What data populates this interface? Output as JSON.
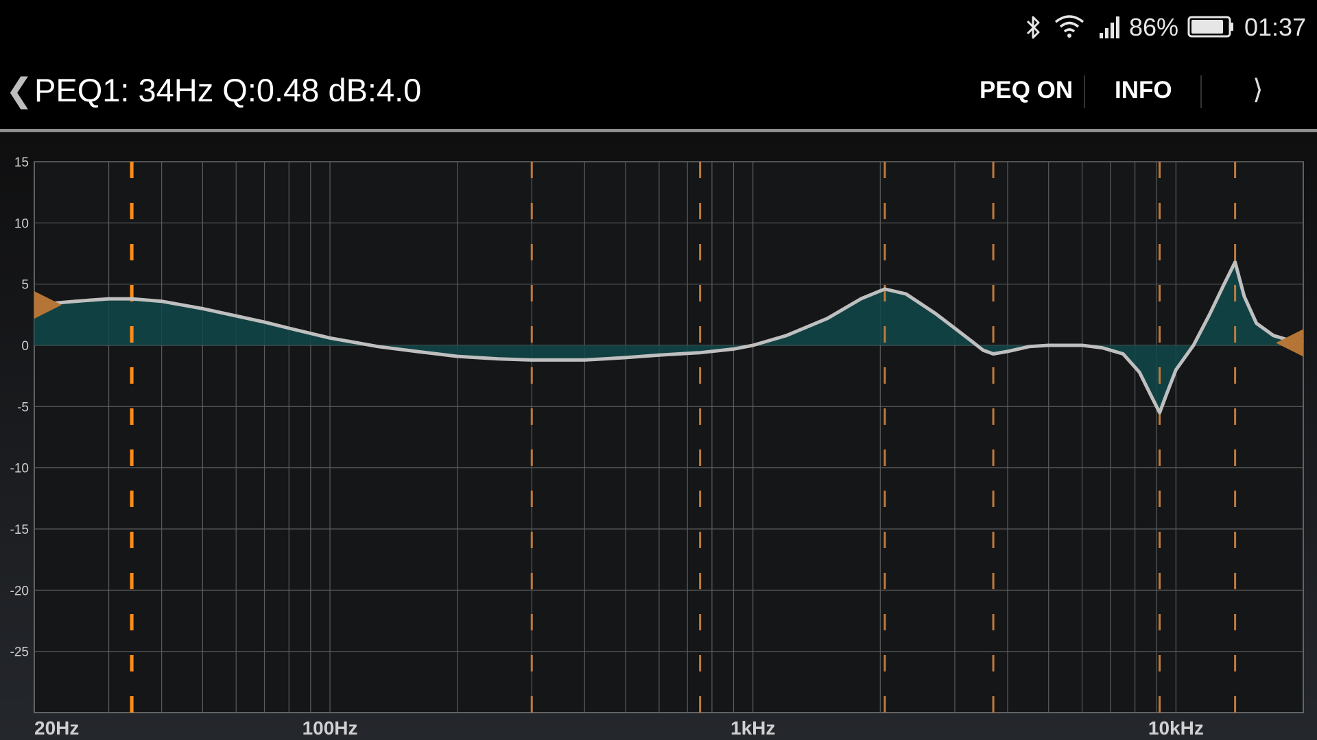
{
  "status_bar": {
    "icons": [
      "bluetooth-icon",
      "wifi-icon",
      "cell-signal-icon",
      "battery-icon"
    ],
    "battery_percent": "86%",
    "time": "01:37"
  },
  "header": {
    "back_icon": "❮",
    "title": "PEQ1: 34Hz Q:0.48 dB:4.0",
    "peq_on_label": "PEQ ON",
    "info_label": "INFO",
    "next_icon": "⟩"
  },
  "colors": {
    "band_marker_active": "#ff8c1a",
    "band_marker": "#c07a3c",
    "curve": "#bfbfbf",
    "fill": "#11484a",
    "handle": "#b57536"
  },
  "chart_data": {
    "type": "line",
    "title": "",
    "x_scale": "log",
    "xlim": [
      20,
      20000
    ],
    "ylim": [
      -30,
      15
    ],
    "y_ticks": [
      15,
      10,
      5,
      0,
      -5,
      -10,
      -15,
      -20,
      -25
    ],
    "x_tick_labels": [
      {
        "value": 20,
        "label": "20Hz"
      },
      {
        "value": 100,
        "label": "100Hz"
      },
      {
        "value": 1000,
        "label": "1kHz"
      },
      {
        "value": 10000,
        "label": "10kHz"
      }
    ],
    "grid": true,
    "band_frequencies": [
      34,
      300,
      750,
      2050,
      3700,
      9150,
      13800
    ],
    "active_band_index": 0,
    "series": [
      {
        "x": [
          20,
          25,
          30,
          34,
          40,
          50,
          60,
          70,
          80,
          100,
          130,
          160,
          200,
          250,
          300,
          400,
          500,
          600,
          750,
          900,
          1000,
          1200,
          1500,
          1800,
          2050,
          2300,
          2700,
          3000,
          3300,
          3500,
          3700,
          4000,
          4500,
          5000,
          6000,
          6700,
          7500,
          8200,
          8700,
          9150,
          9500,
          10000,
          11000,
          12000,
          13000,
          13800,
          14500,
          15500,
          17000,
          19000,
          20000
        ],
        "y": [
          3.3,
          3.6,
          3.8,
          3.8,
          3.6,
          3.0,
          2.4,
          1.9,
          1.4,
          0.6,
          -0.1,
          -0.5,
          -0.9,
          -1.1,
          -1.2,
          -1.2,
          -1.0,
          -0.8,
          -0.6,
          -0.3,
          0.0,
          0.8,
          2.2,
          3.8,
          4.6,
          4.2,
          2.6,
          1.4,
          0.3,
          -0.4,
          -0.7,
          -0.5,
          -0.1,
          0.0,
          0.0,
          -0.2,
          -0.7,
          -2.2,
          -4.0,
          -5.5,
          -4.0,
          -2.0,
          0.0,
          2.5,
          5.0,
          6.8,
          4.0,
          1.8,
          0.8,
          0.3,
          0.2
        ]
      }
    ]
  }
}
